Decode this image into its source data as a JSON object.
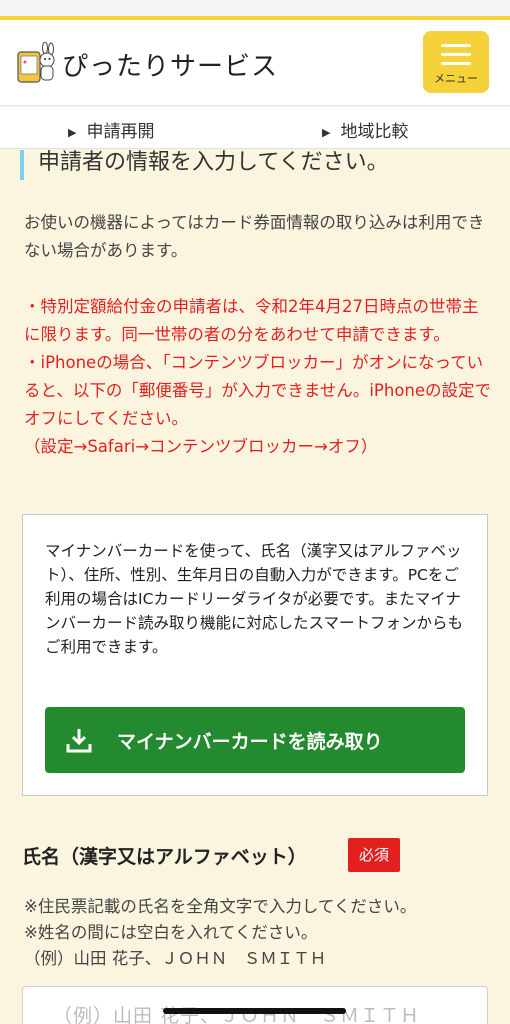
{
  "app": {
    "title": "ぴったりサービス",
    "menu_label": "メニュー",
    "colors": {
      "accent": "#f6d23a",
      "required": "#e32020",
      "primary_button": "#238a2f",
      "title_bar": "#7fd0e8"
    }
  },
  "subnav": {
    "items": [
      {
        "label": "申請再開"
      },
      {
        "label": "地域比較"
      }
    ]
  },
  "section": {
    "title": "申請者の情報を入力してください。",
    "note": "お使いの機器によってはカード券面情報の取り込みは利用できない場合があります。",
    "warnings": [
      "・特別定額給付金の申請者は、令和2年4月27日時点の世帯主に限ります。同一世帯の者の分をあわせて申請できます。",
      "・iPhoneの場合、「コンテンツブロッカー」がオンになっていると、以下の「郵便番号」が入力できません。iPhoneの設定でオフにしてください。",
      "（設定→Safari→コンテンツブロッカー→オフ）"
    ]
  },
  "card": {
    "description": "マイナンバーカードを使って、氏名（漢字又はアルファベット）、住所、性別、生年月日の自動入力ができます。PCをご利用の場合はICカードリーダライタが必要です。またマイナンバーカード読み取り機能に対応したスマートフォンからもご利用できます。",
    "button_label": "マイナンバーカードを読み取り",
    "button_icon": "download-icon"
  },
  "name_field": {
    "label": "氏名（漢字又はアルファベット）",
    "required_badge": "必須",
    "hints": [
      "※住民票記載の氏名を全角文字で入力してください。",
      "※姓名の間には空白を入れてください。",
      "（例）山田 花子、ＪＯＨＮ　ＳＭＩＴＨ"
    ],
    "placeholder": "（例）山田 花子、ＪＯＨＮ　ＳＭＩＴＨ",
    "value": ""
  }
}
